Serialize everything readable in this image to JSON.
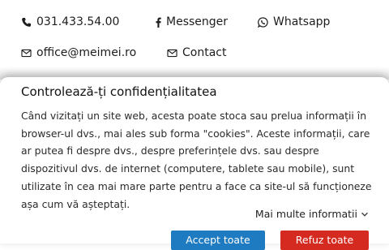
{
  "contacts": {
    "phone": "031.433.54.00",
    "messenger": "Messenger",
    "whatsapp": "Whatsapp",
    "email": "office@meimei.ro",
    "contact": "Contact"
  },
  "icons": {
    "phone": "phone-icon",
    "messenger": "facebook-icon",
    "whatsapp": "whatsapp-icon",
    "email": "envelope-icon",
    "contact": "envelope-icon",
    "more": "chevron-down-icon"
  },
  "consent": {
    "title": "Controlează-ți confidențialitatea",
    "body": "Când vizitați un site web, acesta poate stoca sau prelua informații în browser-ul dvs., mai ales sub forma \"cookies\". Aceste informații, care ar putea fi despre dvs., despre preferințele dvs. sau despre dispozitivul dvs. de internet (computere, tablete sau mobile), sunt utilizate în cea mai mare parte pentru a face ca site-ul să funcționeze așa cum vă așteptați.",
    "more_label": "Mai multe informatii",
    "accept_label": "Accept toate",
    "refuse_label": "Refuz toate"
  },
  "colors": {
    "accept": "#1e7bc1",
    "refuse": "#d42a1f",
    "text": "#222222"
  }
}
